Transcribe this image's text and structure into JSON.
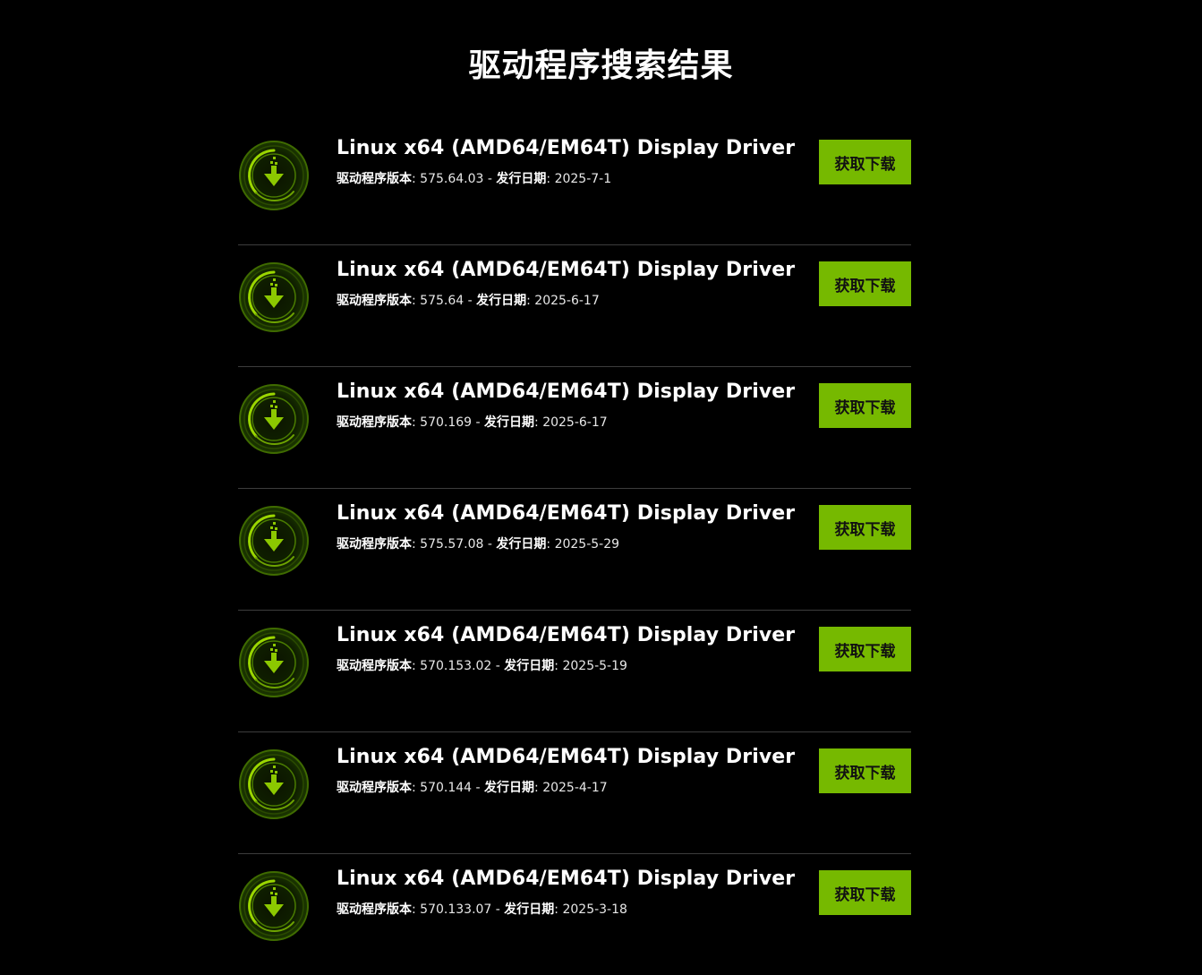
{
  "page": {
    "title": "驱动程序搜索结果"
  },
  "labels": {
    "version_label": "驱动程序版本",
    "date_label": "发行日期",
    "download_button": "获取下载"
  },
  "colors": {
    "accent": "#76b900",
    "background": "#000000",
    "divider": "#3d3d3d"
  },
  "results": [
    {
      "name": "Linux x64 (AMD64/EM64T) Display Driver",
      "version": "575.64.03",
      "date": "2025-7-1",
      "icon": "download-icon"
    },
    {
      "name": "Linux x64 (AMD64/EM64T) Display Driver",
      "version": "575.64",
      "date": "2025-6-17",
      "icon": "download-icon"
    },
    {
      "name": "Linux x64 (AMD64/EM64T) Display Driver",
      "version": "570.169",
      "date": "2025-6-17",
      "icon": "download-icon"
    },
    {
      "name": "Linux x64 (AMD64/EM64T) Display Driver",
      "version": "575.57.08",
      "date": "2025-5-29",
      "icon": "download-icon"
    },
    {
      "name": "Linux x64 (AMD64/EM64T) Display Driver",
      "version": "570.153.02",
      "date": "2025-5-19",
      "icon": "download-icon"
    },
    {
      "name": "Linux x64 (AMD64/EM64T) Display Driver",
      "version": "570.144",
      "date": "2025-4-17",
      "icon": "download-icon"
    },
    {
      "name": "Linux x64 (AMD64/EM64T) Display Driver",
      "version": "570.133.07",
      "date": "2025-3-18",
      "icon": "download-icon"
    }
  ]
}
